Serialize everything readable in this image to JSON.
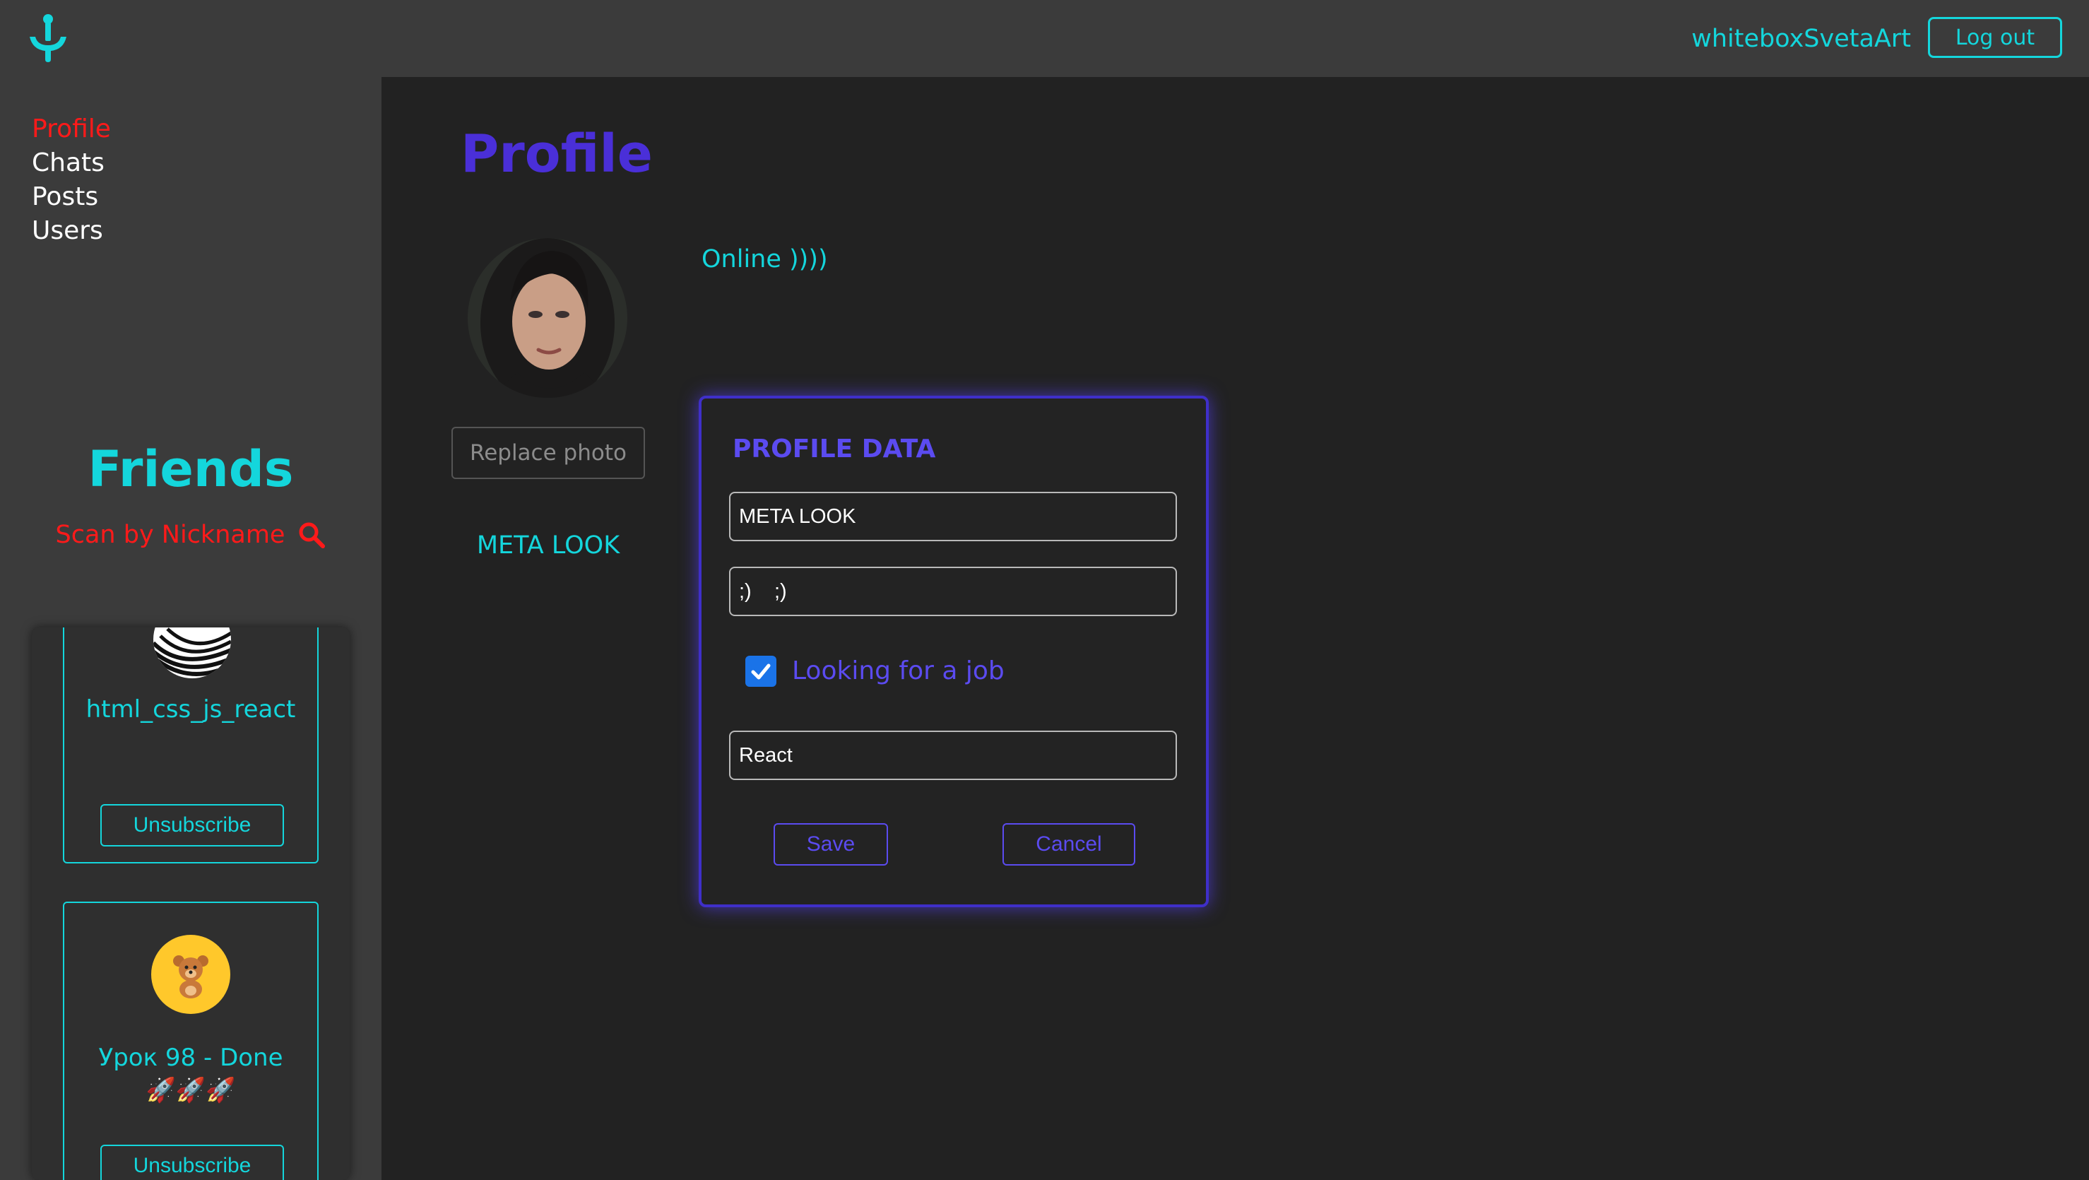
{
  "header": {
    "username": "whiteboxSvetaArt",
    "logout_label": "Log out"
  },
  "sidebar": {
    "nav": [
      {
        "label": "Profile",
        "active": true
      },
      {
        "label": "Chats",
        "active": false
      },
      {
        "label": "Posts",
        "active": false
      },
      {
        "label": "Users",
        "active": false
      }
    ],
    "friends_title": "Friends",
    "scan_label": "Scan by Nickname",
    "friends": [
      {
        "name": "html_css_js_react",
        "button": "Unsubscribe",
        "avatar_icon": "zebra-pattern-avatar"
      },
      {
        "name": "Урок 98 - Done",
        "rockets": "🚀🚀🚀",
        "button": "Unsubscribe",
        "avatar_icon": "teddy-bear-avatar"
      }
    ]
  },
  "main": {
    "title": "Profile",
    "replace_photo_label": "Replace photo",
    "name": "META LOOK",
    "status": "Online ))))",
    "panel": {
      "title": "PROFILE DATA",
      "full_name_value": "META LOOK",
      "about_value": ";)    ;)",
      "looking_for_job": true,
      "looking_for_job_label": "Looking for a job",
      "job_description_value": "React",
      "save_label": "Save",
      "cancel_label": "Cancel"
    }
  },
  "colors": {
    "accent_cyan": "#14d6dc",
    "accent_purple": "#4a2fd8",
    "active_red": "#ff1a1a",
    "header_bg": "#3b3b3b",
    "main_bg": "#222222"
  }
}
